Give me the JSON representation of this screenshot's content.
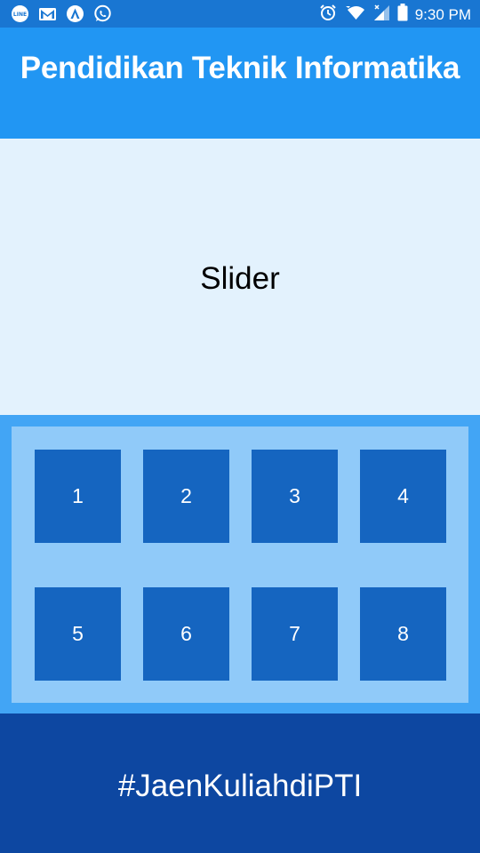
{
  "status_bar": {
    "time": "9:30 PM",
    "left_icons": [
      "line-icon",
      "gmail-icon",
      "vpn-icon",
      "whatsapp-icon"
    ],
    "right_icons": [
      "alarm-icon",
      "wifi-icon",
      "signal-icon",
      "battery-icon"
    ]
  },
  "header": {
    "title": "Pendidikan Teknik Informatika"
  },
  "slider": {
    "label": "Slider"
  },
  "menu": {
    "items": [
      {
        "label": "1"
      },
      {
        "label": "2"
      },
      {
        "label": "3"
      },
      {
        "label": "4"
      },
      {
        "label": "5"
      },
      {
        "label": "6"
      },
      {
        "label": "7"
      },
      {
        "label": "8"
      }
    ]
  },
  "footer": {
    "text": "#JaenKuliahdiPTI"
  },
  "colors": {
    "status_bar": "#1976D2",
    "header": "#2196F3",
    "slider_bg": "#E3F2FD",
    "menu_outer": "#42A5F5",
    "menu_inner": "#90CAF9",
    "tile": "#1565C0",
    "footer": "#0D47A1"
  }
}
